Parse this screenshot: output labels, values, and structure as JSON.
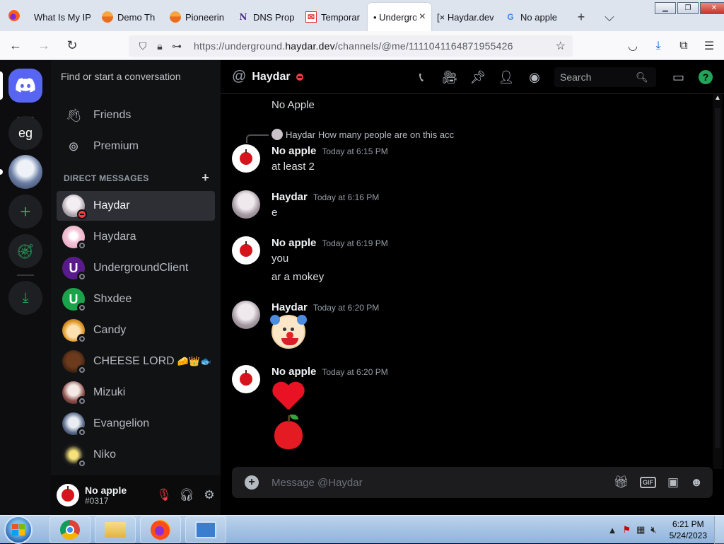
{
  "browser": {
    "tabs": [
      {
        "label": "What Is My IP",
        "favicon": "globe-icon"
      },
      {
        "label": "Demo Th",
        "favicon": "orange-circle-icon"
      },
      {
        "label": "Pioneerin",
        "favicon": "orange-circle-icon"
      },
      {
        "label": "DNS Prop",
        "favicon": "n-logo-icon"
      },
      {
        "label": "Temporar",
        "favicon": "mail-icon"
      },
      {
        "label": "• Undergro",
        "favicon": "none",
        "active": true
      },
      {
        "label": "[× Haydar.dev",
        "favicon": "none"
      },
      {
        "label": "No apple",
        "favicon": "google-icon"
      }
    ],
    "new_tab": "+",
    "list_all_tabs": "⌵",
    "url_prefix": "https://underground.",
    "url_domain": "haydar.dev",
    "url_path": "/channels/@me/1111041164871955426"
  },
  "discord": {
    "search_placeholder": "Find or start a conversation",
    "servers": [
      {
        "label": "eg"
      }
    ],
    "nav": {
      "friends": "Friends",
      "premium": "Premium"
    },
    "dm_header": "DIRECT MESSAGES",
    "dms": [
      {
        "name": "Haydar",
        "status": "dnd",
        "active": true
      },
      {
        "name": "Haydara",
        "status": "offline"
      },
      {
        "name": "UndergroundClient",
        "status": "offline"
      },
      {
        "name": "Shxdee",
        "status": "offline"
      },
      {
        "name": "Candy",
        "status": "offline"
      },
      {
        "name": "CHEESE LORD",
        "status": "offline",
        "emojis": "🧀👑🐟"
      },
      {
        "name": "Mizuki",
        "status": "offline"
      },
      {
        "name": "Evangelion",
        "status": "offline"
      },
      {
        "name": "Niko",
        "status": "offline"
      }
    ],
    "user": {
      "name": "No apple",
      "tag": "#0317"
    },
    "channel": {
      "title": "Haydar",
      "search_placeholder": "Search"
    },
    "messages": {
      "top_text": "No Apple",
      "reply": {
        "author": "Haydar",
        "text": "How many people are on this acc"
      },
      "m1": {
        "author": "No apple",
        "time": "Today at 6:15 PM",
        "lines": [
          "at least 2"
        ]
      },
      "m2": {
        "author": "Haydar",
        "time": "Today at 6:16 PM",
        "lines": [
          "e"
        ]
      },
      "m3": {
        "author": "No apple",
        "time": "Today at 6:19 PM",
        "lines": [
          "you",
          "ar a mokey"
        ]
      },
      "m4": {
        "author": "Haydar",
        "time": "Today at 6:20 PM",
        "emoji": "clown-face"
      },
      "m5": {
        "author": "No apple",
        "time": "Today at 6:20 PM",
        "emojis": [
          "red-heart",
          "red-apple"
        ]
      }
    },
    "composer_placeholder": "Message @Haydar",
    "gif_label": "GIF",
    "colors": {
      "blurple": "#5865f2",
      "green": "#23a559",
      "dnd": "#f23f43"
    }
  },
  "taskbar": {
    "time": "6:21 PM",
    "date": "5/24/2023"
  }
}
